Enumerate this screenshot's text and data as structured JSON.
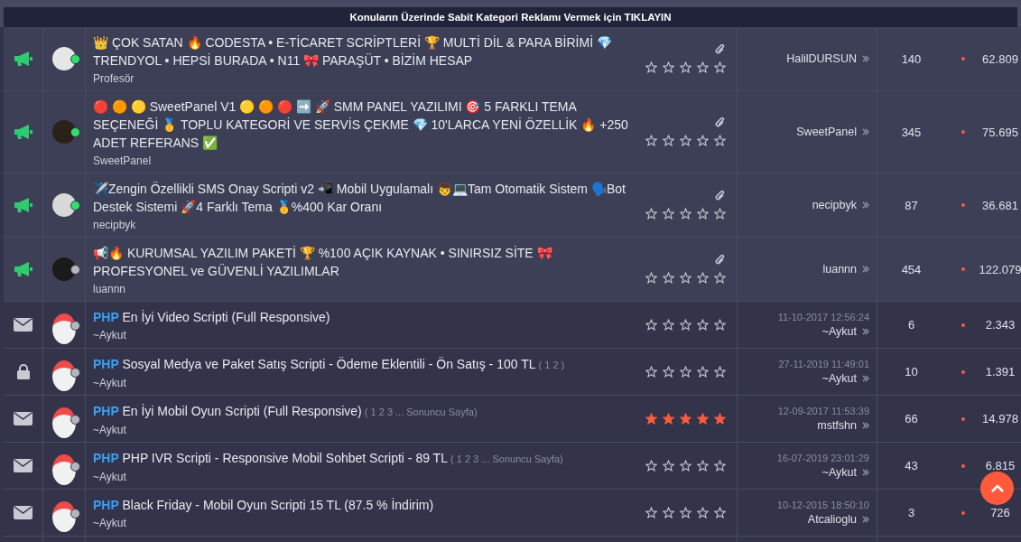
{
  "banner": {
    "text": "Konuların Üzerinde Sabit Kategori Reklamı Vermek için TIKLAYIN"
  },
  "threads": [
    {
      "kind": "sticky",
      "online": true,
      "title": "👑 ÇOK SATAN 🔥 CODESTA • E-TİCARET SCRİPTLERİ 🏆 MULTİ DİL & PARA BİRİMİ 💎 TRENDYOL • HEPSİ BURADA • N11 🎀 PARAŞÜT • BİZİM HESAP",
      "author": "Profesör",
      "attachment": true,
      "stars": 0,
      "last_poster": "HalilDURSUN",
      "replies": "140",
      "views": "62.809"
    },
    {
      "kind": "sticky",
      "online": true,
      "title": "🔴 🟠 🟡 SweetPanel V1 🟡 🟠 🔴 ➡️ 🚀 SMM PANEL YAZILIMI 🎯 5 FARKLI TEMA SEÇENEĞİ 🥇 TOPLU KATEGORİ VE SERVİS ÇEKME 💎 10'LARCA YENİ ÖZELLİK 🔥 +250 ADET REFERANS ✅",
      "author": "SweetPanel",
      "attachment": true,
      "stars": 0,
      "last_poster": "SweetPanel",
      "replies": "345",
      "views": "75.695"
    },
    {
      "kind": "sticky",
      "online": true,
      "title": "✈️Zengin Özellikli SMS Onay Scripti v2 📲 Mobil Uygulamalı 👦💻Tam Otomatik Sistem 🗣️Bot Destek Sistemi 🚀4 Farklı Tema 🥇%400 Kar Oranı",
      "author": "necipbyk",
      "attachment": true,
      "stars": 0,
      "last_poster": "necipbyk",
      "replies": "87",
      "views": "36.681"
    },
    {
      "kind": "sticky",
      "online": false,
      "title": "📢🔥 KURUMSAL YAZILIM PAKETİ 🏆 %100 AÇIK KAYNAK • SINIRSIZ SİTE 🎀 PROFESYONEL ve GÜVENLİ YAZILIMLAR",
      "author": "luannn",
      "attachment": true,
      "stars": 0,
      "last_poster": "luannn",
      "replies": "454",
      "views": "122.079"
    },
    {
      "kind": "normal",
      "locked": false,
      "online": false,
      "prefix": "PHP",
      "title": "En İyi Video Scripti (Full Responsive)",
      "author": "~Aykut",
      "stars": 0,
      "last_date": "11-10-2017 12:56:24",
      "last_poster": "~Aykut",
      "replies": "6",
      "views": "2.343"
    },
    {
      "kind": "normal",
      "locked": true,
      "online": false,
      "prefix": "PHP",
      "title": "Sosyal Medya ve Paket Satış Scripti - Ödeme Eklentili - Ön Satış - 100 TL",
      "pages": "( 1 2 )",
      "author": "~Aykut",
      "stars": 0,
      "last_date": "27-11-2019 11:49:01",
      "last_poster": "~Aykut",
      "replies": "10",
      "views": "1.391"
    },
    {
      "kind": "normal",
      "locked": false,
      "online": false,
      "prefix": "PHP",
      "title": "En İyi Mobil Oyun Scripti (Full Responsive)",
      "pages": "( 1 2 3 ... Sonuncu Sayfa)",
      "author": "~Aykut",
      "stars": 5,
      "last_date": "12-09-2017 11:53:39",
      "last_poster": "mstfshn",
      "replies": "66",
      "views": "14.978"
    },
    {
      "kind": "normal",
      "locked": false,
      "online": false,
      "prefix": "PHP",
      "title": "PHP IVR Scripti - Responsive Mobil Sohbet Scripti - 89 TL",
      "pages": "( 1 2 3 ... Sonuncu Sayfa)",
      "author": "~Aykut",
      "stars": 0,
      "last_date": "16-07-2019 23:01:29",
      "last_poster": "~Aykut",
      "replies": "43",
      "views": "6.815"
    },
    {
      "kind": "normal",
      "locked": false,
      "online": false,
      "prefix": "PHP",
      "title": "Black Friday - Mobil Oyun Scripti 15 TL (87.5 % İndirim)",
      "author": "~Aykut",
      "stars": 0,
      "last_date": "10-12-2015 18:50:10",
      "last_poster": "Atcalioglu",
      "replies": "3",
      "views": "726"
    }
  ]
}
